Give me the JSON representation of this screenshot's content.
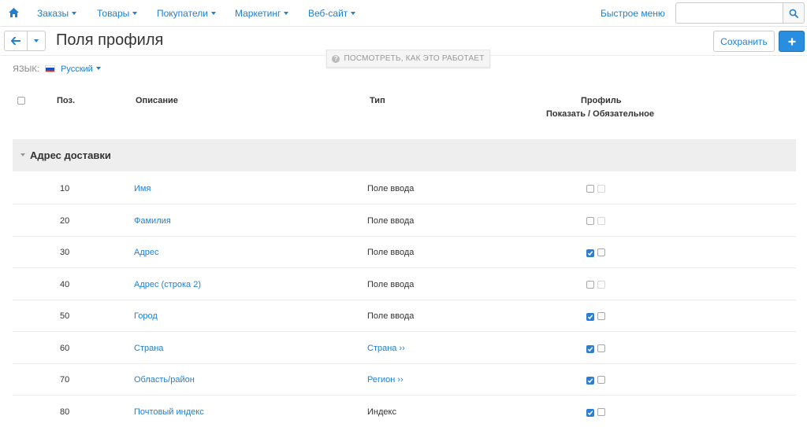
{
  "nav": {
    "home_icon": "home-icon",
    "items": [
      {
        "label": "Заказы"
      },
      {
        "label": "Товары"
      },
      {
        "label": "Покупатели"
      },
      {
        "label": "Маркетинг"
      },
      {
        "label": "Веб-сайт"
      }
    ],
    "quick_menu": "Быстрое меню",
    "search": {
      "value": "",
      "placeholder": ""
    }
  },
  "titlebar": {
    "title": "Поля профиля",
    "save_label": "Сохранить",
    "howto_label": "ПОСМОТРЕТЬ, КАК ЭТО РАБОТАЕТ"
  },
  "language": {
    "label": "ЯЗЫК:",
    "value": "Русский",
    "flag_colors": [
      "#ffffff",
      "#1c4fb8",
      "#d52b1e"
    ]
  },
  "table": {
    "headers": {
      "pos": "Поз.",
      "description": "Описание",
      "type": "Тип",
      "profile": "Профиль",
      "profile_sub": "Показать / Обязательное"
    },
    "group": "Адрес доставки",
    "rows": [
      {
        "pos": "10",
        "description": "Имя",
        "type": "Поле ввода",
        "type_link": false,
        "show": false,
        "required": false
      },
      {
        "pos": "20",
        "description": "Фамилия",
        "type": "Поле ввода",
        "type_link": false,
        "show": false,
        "required": false
      },
      {
        "pos": "30",
        "description": "Адрес",
        "type": "Поле ввода",
        "type_link": false,
        "show": true,
        "required": false
      },
      {
        "pos": "40",
        "description": "Адрес (строка 2)",
        "type": "Поле ввода",
        "type_link": false,
        "show": false,
        "required": false
      },
      {
        "pos": "50",
        "description": "Город",
        "type": "Поле ввода",
        "type_link": false,
        "show": true,
        "required": false
      },
      {
        "pos": "60",
        "description": "Страна",
        "type": "Страна ››",
        "type_link": true,
        "show": true,
        "required": false
      },
      {
        "pos": "70",
        "description": "Область/район",
        "type": "Регион ››",
        "type_link": true,
        "show": true,
        "required": false
      },
      {
        "pos": "80",
        "description": "Почтовый индекс",
        "type": "Индекс",
        "type_link": false,
        "show": true,
        "required": false
      }
    ]
  },
  "colors": {
    "accent": "#1f7fd1",
    "primary_button": "#2a8ee0",
    "checked": "#2a7fd4",
    "group_bg": "#eeeeee"
  }
}
